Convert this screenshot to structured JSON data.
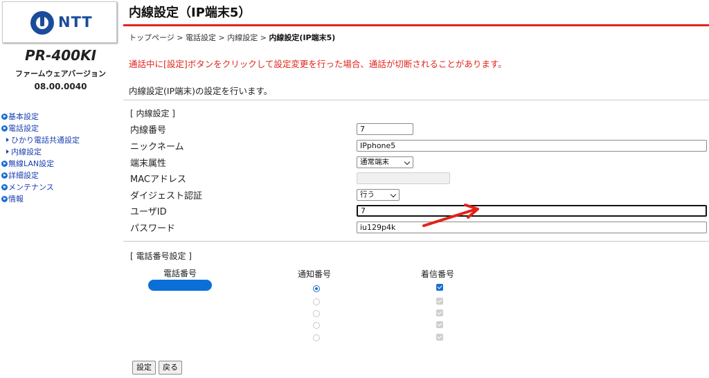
{
  "sidebar": {
    "logo_text": "NTT",
    "model": "PR-400KI",
    "firmware_label": "ファームウェアバージョン",
    "firmware_version": "08.00.0040",
    "items": [
      {
        "label": "基本設定",
        "level": 0
      },
      {
        "label": "電話設定",
        "level": 0
      },
      {
        "label": "ひかり電話共通設定",
        "level": 1
      },
      {
        "label": "内線設定",
        "level": 1
      },
      {
        "label": "無線LAN設定",
        "level": 0
      },
      {
        "label": "詳細設定",
        "level": 0
      },
      {
        "label": "メンテナンス",
        "level": 0
      },
      {
        "label": "情報",
        "level": 0
      }
    ]
  },
  "header": {
    "title": "内線設定（IP端末5）",
    "breadcrumb": {
      "items": [
        "トップページ",
        "電話設定",
        "内線設定"
      ],
      "separator": ">",
      "current": "内線設定(IP端末5)"
    }
  },
  "warning": "通話中に[設定]ボタンをクリックして設定変更を行った場合、通話が切断されることがあります。",
  "description": "内線設定(IP端末)の設定を行います。",
  "extension": {
    "section_title": "[ 内線設定 ]",
    "fields": {
      "number": {
        "label": "内線番号",
        "value": "7"
      },
      "nickname": {
        "label": "ニックネーム",
        "value": "IPphone5"
      },
      "terminal_type": {
        "label": "端末属性",
        "value": "通常端末"
      },
      "mac": {
        "label": "MACアドレス",
        "value": ""
      },
      "digest_auth": {
        "label": "ダイジェスト認証",
        "value": "行う"
      },
      "user_id": {
        "label": "ユーザID",
        "value": "7"
      },
      "password": {
        "label": "パスワード",
        "value": "iu129p4k"
      }
    }
  },
  "phone_numbers": {
    "section_title": "[ 電話番号設定 ]",
    "columns": [
      "電話番号",
      "通知番号",
      "着信番号"
    ],
    "rows": [
      {
        "notify_selected": true,
        "incoming_checked": true,
        "enabled": true
      },
      {
        "notify_selected": false,
        "incoming_checked": true,
        "enabled": false
      },
      {
        "notify_selected": false,
        "incoming_checked": true,
        "enabled": false
      },
      {
        "notify_selected": false,
        "incoming_checked": true,
        "enabled": false
      },
      {
        "notify_selected": false,
        "incoming_checked": true,
        "enabled": false
      }
    ]
  },
  "buttons": {
    "save": "設定",
    "back": "戻る"
  },
  "colors": {
    "brand_blue": "#1a4c9c",
    "accent_red": "#e2231a",
    "link_blue": "#1a3fb0",
    "redaction_blue": "#0a6fd6"
  }
}
